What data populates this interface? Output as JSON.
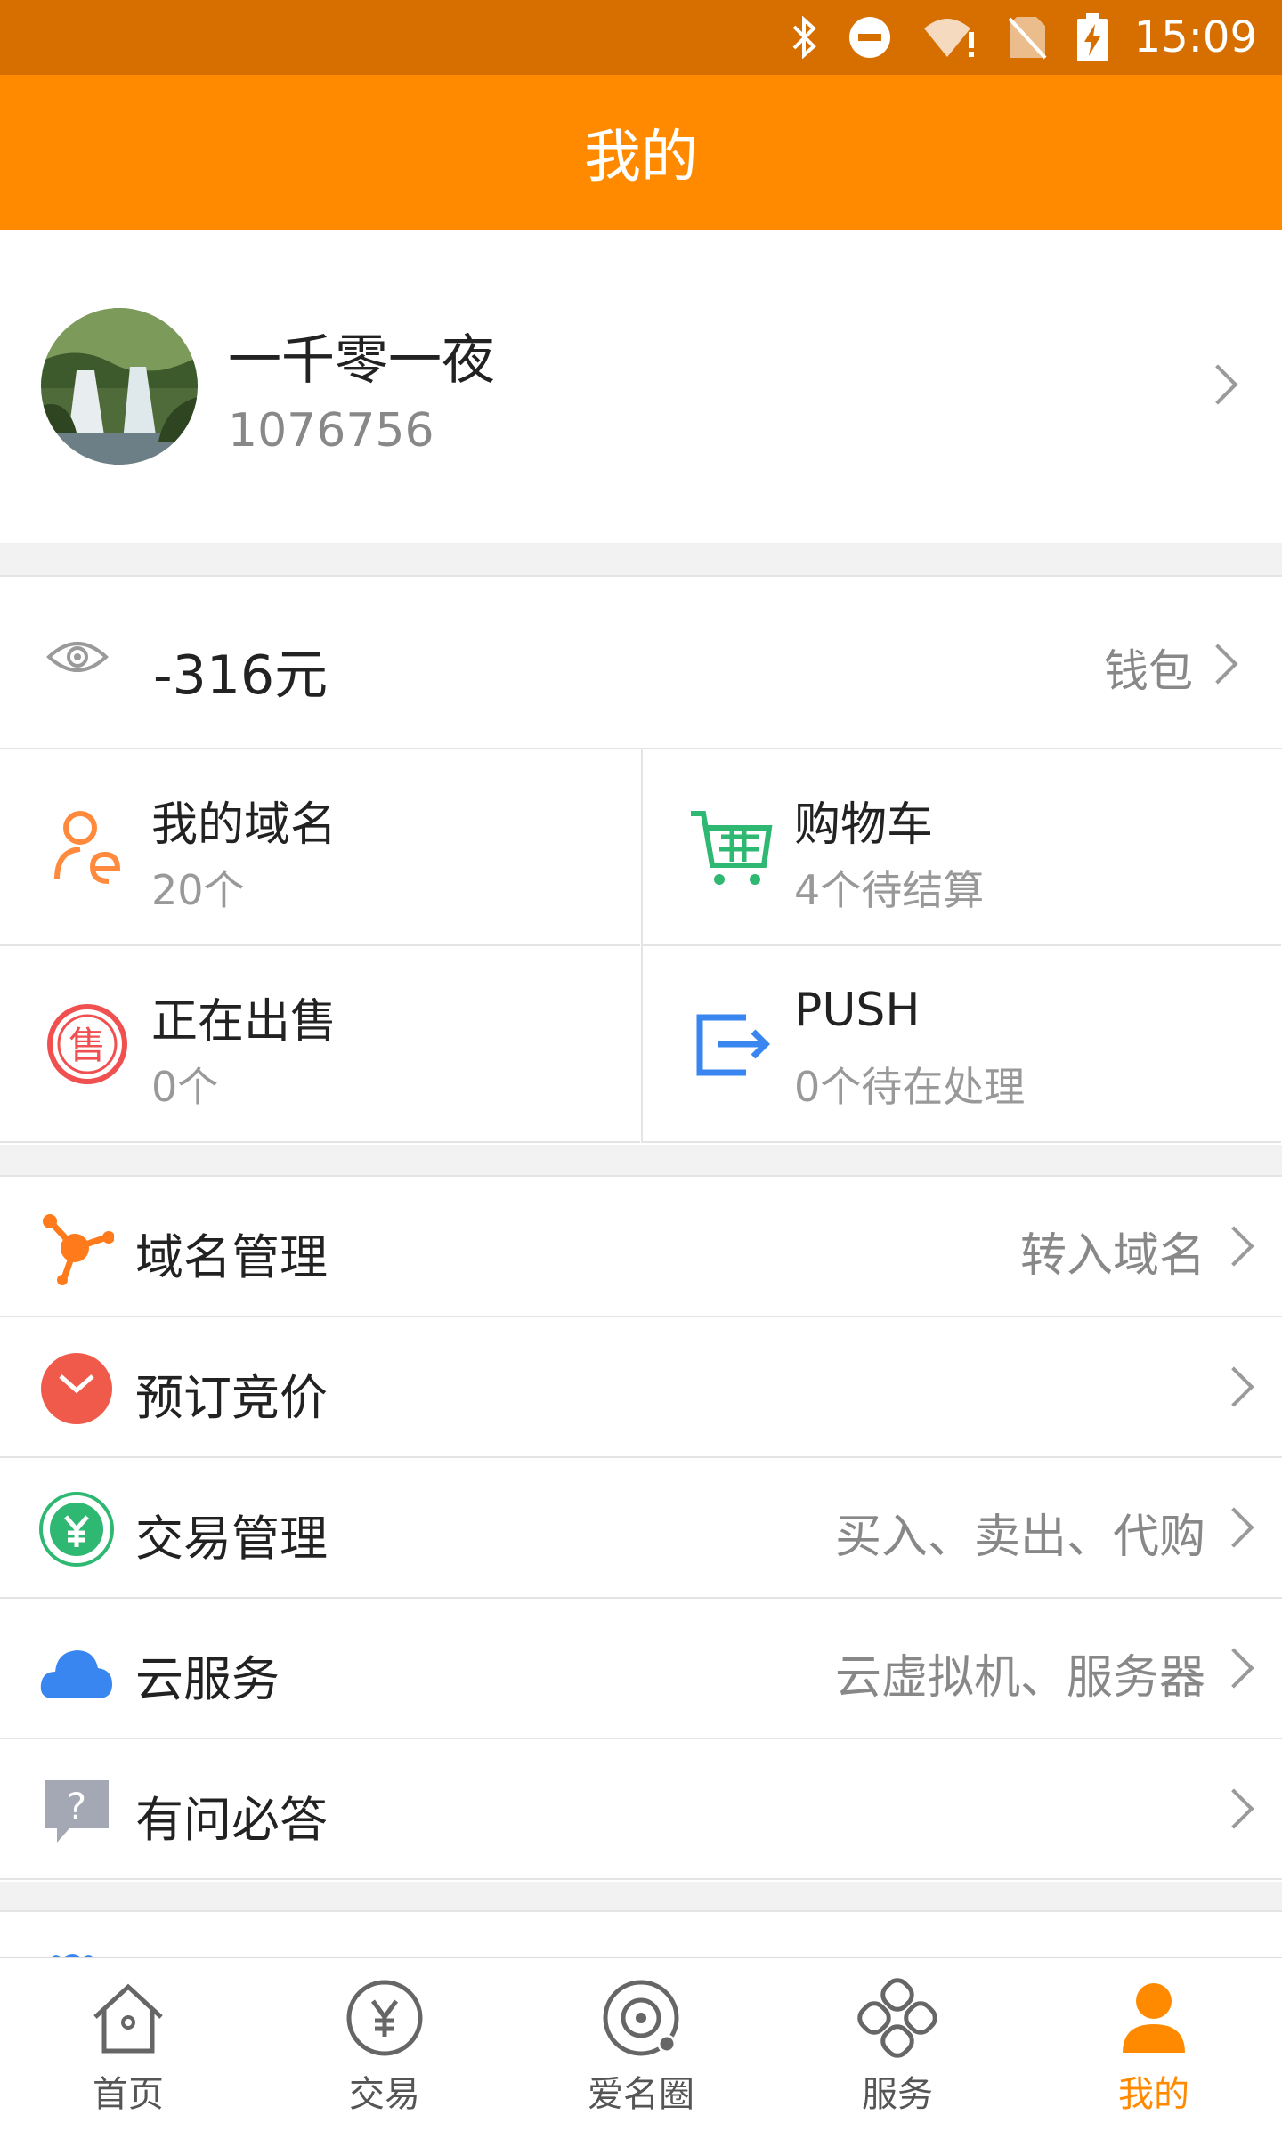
{
  "status_bar": {
    "time": "15:09",
    "icons": [
      "bluetooth-icon",
      "dnd-icon",
      "wifi-alert-icon",
      "no-sim-icon",
      "battery-charging-icon"
    ]
  },
  "header": {
    "title": "我的"
  },
  "profile": {
    "name": "一千零一夜",
    "id": "1076756"
  },
  "wallet": {
    "balance": "-316元",
    "link_label": "钱包"
  },
  "grid": [
    {
      "title": "我的域名",
      "sub": "20个",
      "icon": "user-domain-icon",
      "color": "#ff8a3d"
    },
    {
      "title": "购物车",
      "sub": "4个待结算",
      "icon": "cart-icon",
      "color": "#2eb872"
    },
    {
      "title": "正在出售",
      "sub": "0个",
      "icon": "sale-icon",
      "color": "#f05050"
    },
    {
      "title": "PUSH",
      "sub": "0个待在处理",
      "icon": "push-icon",
      "color": "#3a86f0"
    }
  ],
  "menu": [
    {
      "label": "域名管理",
      "sub": "转入域名",
      "icon": "domain-manage-icon"
    },
    {
      "label": "预订竞价",
      "sub": "",
      "icon": "bid-clock-icon"
    },
    {
      "label": "交易管理",
      "sub": "买入、卖出、代购",
      "icon": "trade-icon"
    },
    {
      "label": "云服务",
      "sub": "云虚拟机、服务器",
      "icon": "cloud-icon"
    },
    {
      "label": "有问必答",
      "sub": "",
      "icon": "question-icon"
    }
  ],
  "tabs": [
    {
      "label": "首页",
      "icon": "home-icon"
    },
    {
      "label": "交易",
      "icon": "yen-icon"
    },
    {
      "label": "爱名圈",
      "icon": "circle-icon"
    },
    {
      "label": "服务",
      "icon": "service-icon"
    },
    {
      "label": "我的",
      "icon": "person-icon",
      "active": true
    }
  ],
  "colors": {
    "accent": "#ff8a00",
    "status_bar": "#d66e00"
  }
}
